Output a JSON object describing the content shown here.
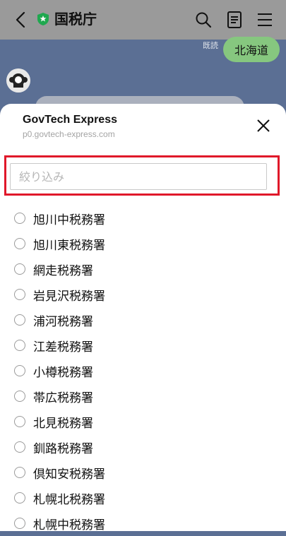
{
  "header": {
    "title": "国税庁",
    "icons": [
      "back-arrow-icon",
      "verified-shield-icon",
      "search-icon",
      "notes-icon",
      "menu-icon"
    ]
  },
  "chat": {
    "read_mark": "既読",
    "sent_message": "北海道"
  },
  "sheet": {
    "title": "GovTech Express",
    "url": "p0.govtech-express.com",
    "search_placeholder": "絞り込み",
    "search_value": "",
    "options": [
      {
        "label": "旭川中税務署"
      },
      {
        "label": "旭川東税務署"
      },
      {
        "label": "網走税務署"
      },
      {
        "label": "岩見沢税務署"
      },
      {
        "label": "浦河税務署"
      },
      {
        "label": "江差税務署"
      },
      {
        "label": "小樽税務署"
      },
      {
        "label": "帯広税務署"
      },
      {
        "label": "北見税務署"
      },
      {
        "label": "釧路税務署"
      },
      {
        "label": "倶知安税務署"
      },
      {
        "label": "札幌北税務署"
      },
      {
        "label": "札幌中税務署"
      }
    ]
  },
  "colors": {
    "highlight_border": "#e0182a",
    "sent_bubble": "#86c77f",
    "chat_background": "#5b6f94"
  }
}
